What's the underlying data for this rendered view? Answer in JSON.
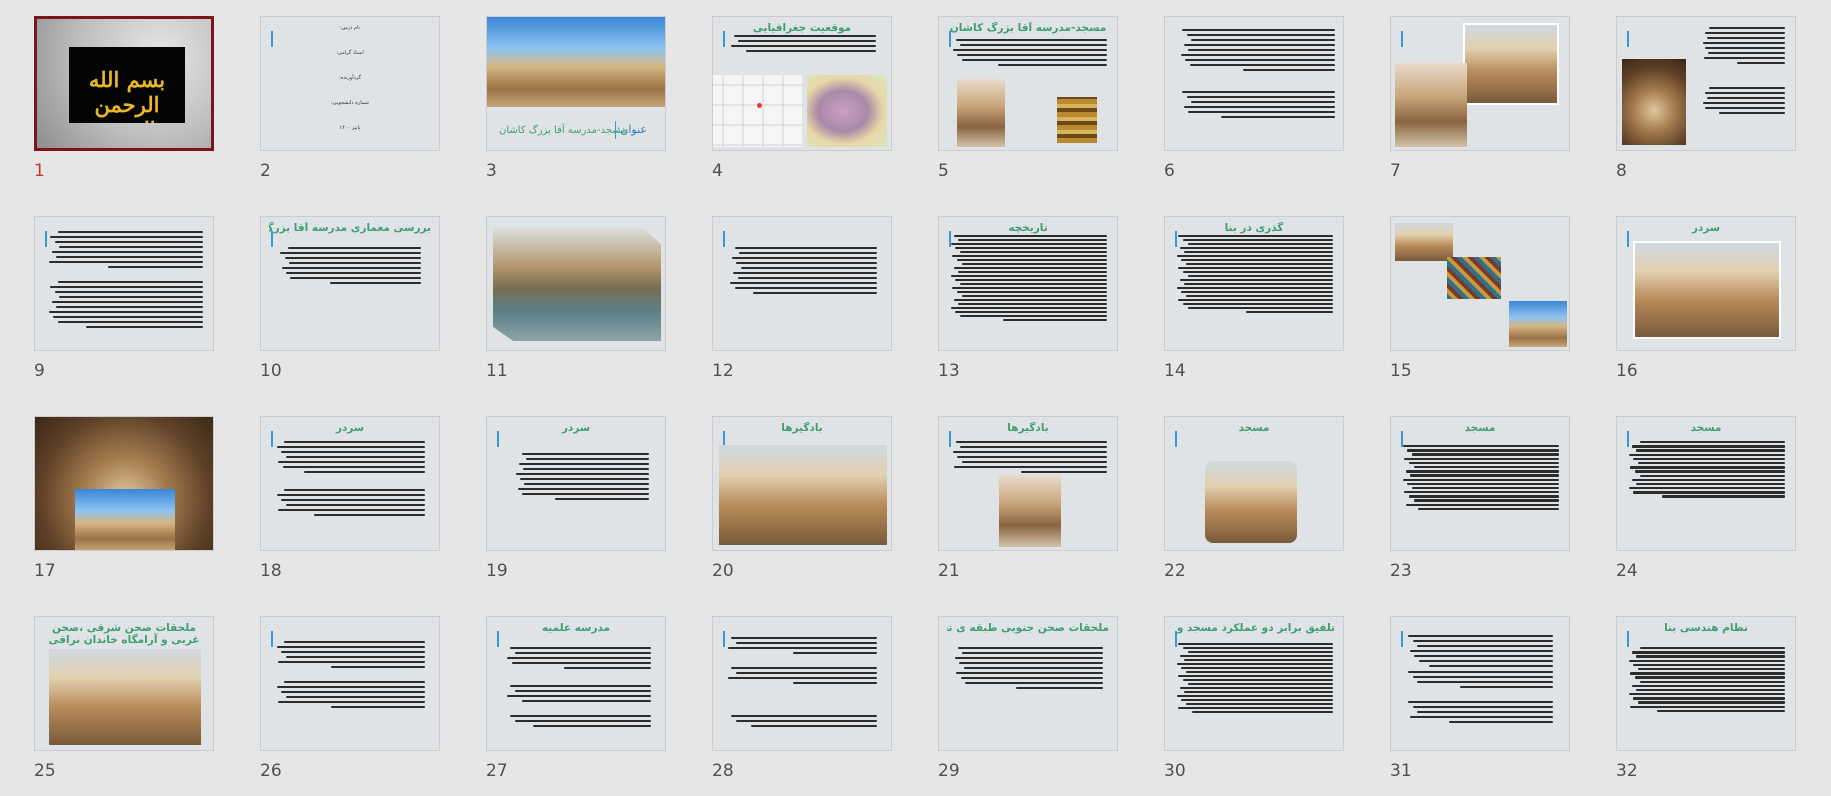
{
  "colors": {
    "background": "#e6e6e6",
    "slide": "#dfe3e6",
    "selection": "#7a1519",
    "accent_bar": "#3a9ad9",
    "title_text": "#3f9e70",
    "gold_text": "#e8b62a"
  },
  "cover_text": "بسم الله الرحمن الرحیم",
  "slide2_fields": [
    "نام درس:",
    "استاد گرامی:",
    "گردآورنده:",
    "شماره دانشجویی:",
    "پاییز ۱۴۰۰"
  ],
  "slide3": {
    "label": "عنوان:",
    "title": "مسجد-مدرسه آقا بزرگ کاشان"
  },
  "slides": [
    {
      "number": "1",
      "title": ""
    },
    {
      "number": "2",
      "title": ""
    },
    {
      "number": "3",
      "title": ""
    },
    {
      "number": "4",
      "title": "موقعیت جغرافیایی"
    },
    {
      "number": "5",
      "title": "مسجد-مدرسه آقا بزرگ کاشان"
    },
    {
      "number": "6",
      "title": ""
    },
    {
      "number": "7",
      "title": ""
    },
    {
      "number": "8",
      "title": ""
    },
    {
      "number": "9",
      "title": ""
    },
    {
      "number": "10",
      "title": "بررسی معماری مدرسه آقا بزرگ کاشان"
    },
    {
      "number": "11",
      "title": ""
    },
    {
      "number": "12",
      "title": ""
    },
    {
      "number": "13",
      "title": "تاریخچه"
    },
    {
      "number": "14",
      "title": "گذری در بنا"
    },
    {
      "number": "15",
      "title": ""
    },
    {
      "number": "16",
      "title": "سردر"
    },
    {
      "number": "17",
      "title": ""
    },
    {
      "number": "18",
      "title": "سردر"
    },
    {
      "number": "19",
      "title": "سردر"
    },
    {
      "number": "20",
      "title": "بادگیرها"
    },
    {
      "number": "21",
      "title": "بادگیرها"
    },
    {
      "number": "22",
      "title": "مسجد"
    },
    {
      "number": "23",
      "title": "مسجد"
    },
    {
      "number": "24",
      "title": "مسجد"
    },
    {
      "number": "25",
      "title": "ملحقات صحن شرقی ،صحن غربی و آرامگاه خاندان نراقی"
    },
    {
      "number": "26",
      "title": ""
    },
    {
      "number": "27",
      "title": "مدرسه علمیه"
    },
    {
      "number": "28",
      "title": ""
    },
    {
      "number": "29",
      "title": "ملحقات صحن جنوبی طبقه ی تحتانی:"
    },
    {
      "number": "30",
      "title": "تلفیق برابر دو عملکرد مسجد و مدرسه"
    },
    {
      "number": "31",
      "title": ""
    },
    {
      "number": "32",
      "title": "نظام هندسی بنا"
    }
  ]
}
